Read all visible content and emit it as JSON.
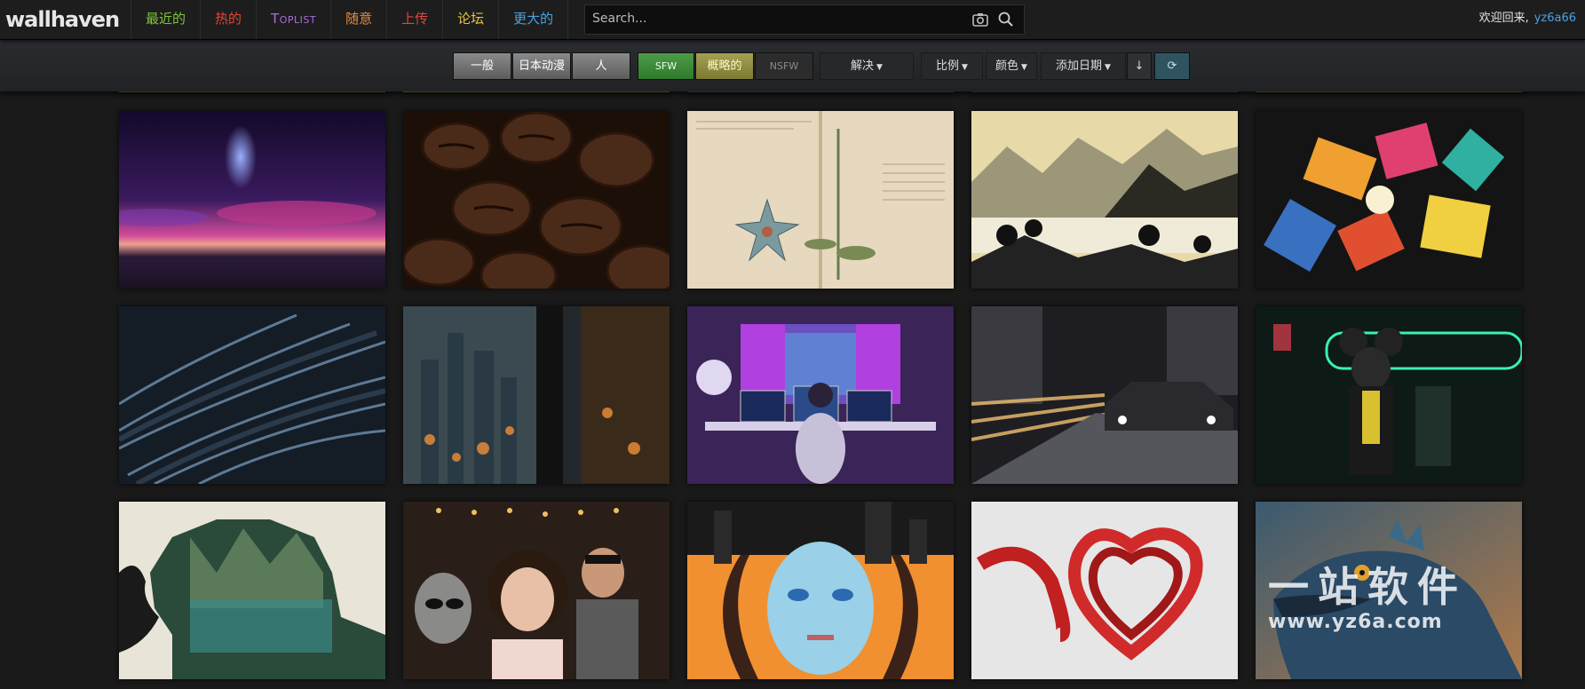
{
  "app": {
    "logo": "wallhaven"
  },
  "nav": [
    {
      "label": "最近的",
      "color": "#7ec53c"
    },
    {
      "label": "热的",
      "color": "#e0463a"
    },
    {
      "label": "Toplist",
      "color": "#a86fe0"
    },
    {
      "label": "随意",
      "color": "#e98a3a"
    },
    {
      "label": "上传",
      "color": "#e0463a"
    },
    {
      "label": "论坛",
      "color": "#e9c43a"
    },
    {
      "label": "更大的",
      "color": "#4aa3df"
    }
  ],
  "search": {
    "placeholder": "Search..."
  },
  "user": {
    "welcome": "欢迎回来,",
    "name": "yz6a66"
  },
  "filters": {
    "categories": [
      "一般",
      "日本动漫",
      "人"
    ],
    "purity": {
      "sfw": "SFW",
      "sketchy": "概略的",
      "nsfw": "NSFW"
    },
    "resolution": "解决",
    "ratio": "比例",
    "color": "颜色",
    "sort": "添加日期"
  },
  "watermark": {
    "line1": "一站软件",
    "line2": "www.yz6a.com"
  },
  "wallpapers": [
    [
      "nebula-sky",
      "coffee-beans",
      "botanical-manuscript",
      "ink-landscape",
      "abstract-paint"
    ],
    [
      "dark-feathers",
      "city-window-bokeh",
      "gaming-room",
      "night-car",
      "neon-mouse"
    ],
    [
      "double-exposure-forest",
      "alien-party",
      "glitch-face",
      "red-ribbon-heart",
      "lizard"
    ]
  ],
  "colors": {
    "accent": "#4aa3df",
    "background": "#1a1a1a"
  }
}
